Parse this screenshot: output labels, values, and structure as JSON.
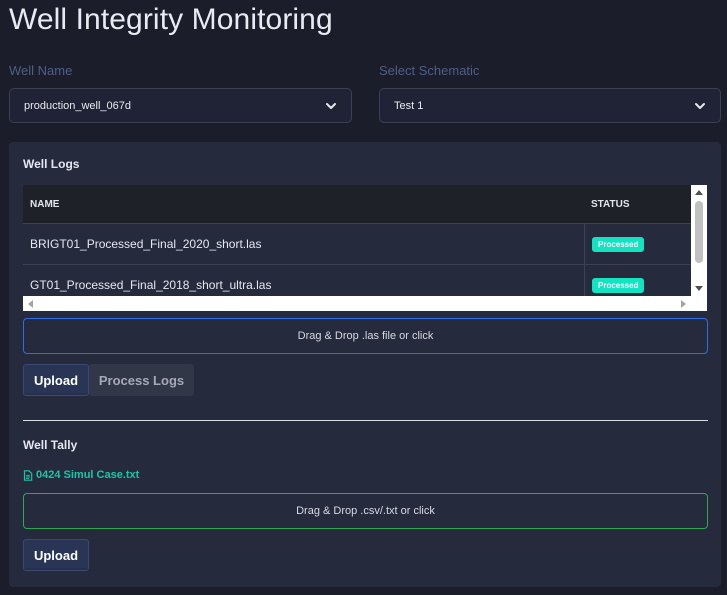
{
  "page": {
    "title": "Well Integrity Monitoring"
  },
  "well_select": {
    "label": "Well Name",
    "value": "production_well_067d"
  },
  "schematic_select": {
    "label": "Select Schematic",
    "value": "Test 1"
  },
  "well_logs": {
    "title": "Well Logs",
    "columns": [
      "NAME",
      "STATUS"
    ],
    "rows": [
      {
        "name": "BRIGT01_Processed_Final_2020_short.las",
        "status": "Processed"
      },
      {
        "name": "GT01_Processed_Final_2018_short_ultra.las",
        "status": "Processed"
      }
    ],
    "dropzone_text": "Drag & Drop .las file or click",
    "upload_label": "Upload",
    "process_label": "Process Logs"
  },
  "well_tally": {
    "title": "Well Tally",
    "file_name": "0424 Simul Case.txt",
    "dropzone_text": "Drag & Drop .csv/.txt or click",
    "upload_label": "Upload"
  },
  "colors": {
    "background": "#1b1d2b",
    "panel": "#262a3d",
    "badge": "#12e3c1",
    "las_dropzone_border": "#2c6ee8",
    "csv_dropzone_border": "#2fa84f",
    "file_link": "#19c7a6"
  },
  "icons": [
    "chevron-down-icon",
    "file-icon",
    "scroll-up-icon",
    "scroll-down-icon",
    "scroll-left-icon",
    "scroll-right-icon"
  ]
}
